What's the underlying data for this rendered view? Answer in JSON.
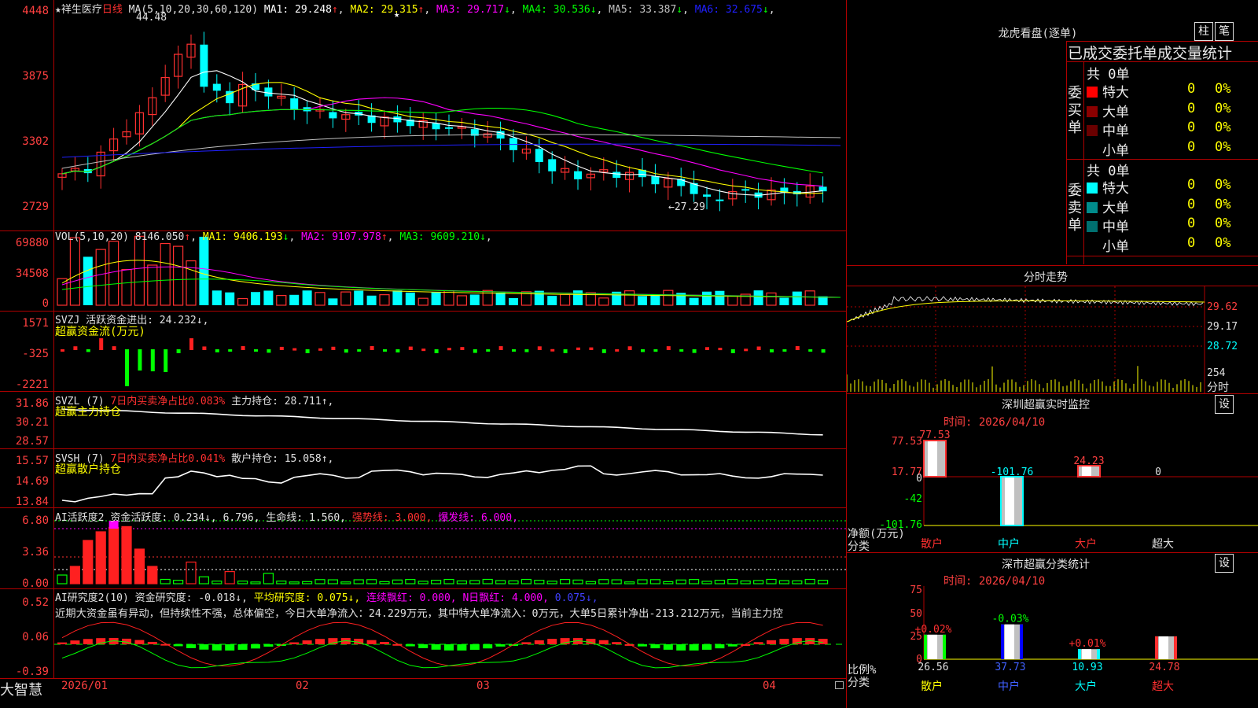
{
  "stock_name": "★祥生医疗",
  "period_tag": "日线",
  "ma_header": {
    "label": "MA(5,10,20,30,60,120)",
    "items": [
      {
        "name": "MA1",
        "value": "29.248",
        "arrow": "↑",
        "color": "#ffffff"
      },
      {
        "name": "MA2",
        "value": "29.315",
        "arrow": "↑",
        "color": "#ffff00"
      },
      {
        "name": "MA3",
        "value": "29.717",
        "arrow": "↓",
        "color": "#ff00ff"
      },
      {
        "name": "MA4",
        "value": "30.536",
        "arrow": "↓",
        "color": "#00ff00"
      },
      {
        "name": "MA5",
        "value": "33.387",
        "arrow": "↓",
        "color": "#c0c0c0"
      },
      {
        "name": "MA6",
        "value": "32.675",
        "arrow": "↓",
        "color": "#2020ff"
      }
    ]
  },
  "price_axis": [
    "4448",
    "3875",
    "3302",
    "2729"
  ],
  "high_mark": "44.48",
  "low_mark": "←27.29",
  "vol_header": {
    "label": "VOL(5,10,20)",
    "value": "8146.050",
    "arrow": "↑",
    "items": [
      {
        "name": "MA1",
        "value": "9406.193",
        "arrow": "↓",
        "color": "#ffff00"
      },
      {
        "name": "MA2",
        "value": "9107.978",
        "arrow": "↑",
        "color": "#ff00ff"
      },
      {
        "name": "MA3",
        "value": "9609.210",
        "arrow": "↓",
        "color": "#00ff00"
      }
    ]
  },
  "vol_axis": [
    "69880",
    "34508",
    "0"
  ],
  "svzj": {
    "line1": "SVZJ  活跃资金进出: 24.232↓,",
    "line2": "超赢资金流(万元)",
    "axis": [
      "1571",
      "-325",
      "-2221"
    ]
  },
  "svzl": {
    "line1_a": "SVZL (7)",
    "line1_b": "7日内买卖净占比0.083%",
    "line1_c": "主力持仓: 28.711↑,",
    "line2": "超赢主力持仓",
    "axis": [
      "31.86",
      "30.21",
      "28.57"
    ]
  },
  "svsh": {
    "line1_a": "SVSH (7)",
    "line1_b": "7日内买卖净占比0.041%",
    "line1_c": "散户持仓: 15.058↑,",
    "line2": "超赢散户持仓",
    "axis": [
      "15.57",
      "14.69",
      "13.84"
    ]
  },
  "ai2": {
    "a": "AI活跃度2",
    "b": "资金活跃度: 0.234↓,",
    "c": "6.796,",
    "d": "生命线: 1.560,",
    "e": "强势线: 3.000,",
    "f": "爆发线: 6.000,",
    "axis": [
      "6.80",
      "3.36",
      "0.00"
    ]
  },
  "ai_research": {
    "a": "AI研究度2(10)",
    "b": "资金研究度: -0.018↓,",
    "c": "平均研究度: 0.075↓,",
    "d": "连续飘红: 0.000,",
    "e": "N日飘红: 4.000,",
    "f": "0.075↓,",
    "text": "近期大资金虽有异动，但持续性不强，总体偏空，今日大单净流入：24.229万元，其中特大单净流入：0万元，大单5日累计净出-213.212万元，当前主力控",
    "axis": [
      "0.52",
      "0.06",
      "-0.39"
    ]
  },
  "date_axis": [
    "2026/01",
    "02",
    "03",
    "04"
  ],
  "brand": "大智慧",
  "right": {
    "dragon_title": "龙虎看盘(逐单)",
    "btn_pillar": "柱",
    "btn_deal": "笔",
    "stat_title": "已成交委托单成交量统计",
    "buy_label": "委买单",
    "sell_label": "委卖单",
    "buy_total": "共 0单",
    "sell_total": "共 0单",
    "buy_rows": [
      {
        "label": "特大",
        "count": "0",
        "pct": "0%",
        "color": "#ff0000"
      },
      {
        "label": "大单",
        "count": "0",
        "pct": "0%",
        "color": "#8b0000"
      },
      {
        "label": "中单",
        "count": "0",
        "pct": "0%",
        "color": "#6a0000"
      },
      {
        "label": "小单",
        "count": "0",
        "pct": "0%",
        "color": "#000000"
      }
    ],
    "sell_rows": [
      {
        "label": "特大",
        "count": "0",
        "pct": "0%",
        "color": "#00ffff"
      },
      {
        "label": "大单",
        "count": "0",
        "pct": "0%",
        "color": "#008b8b"
      },
      {
        "label": "中单",
        "count": "0",
        "pct": "0%",
        "color": "#007070"
      },
      {
        "label": "小单",
        "count": "0",
        "pct": "0%",
        "color": "#000000"
      }
    ],
    "intraday_title": "分时走势",
    "intraday_axis": [
      "29.62",
      "29.17",
      "28.72"
    ],
    "intraday_vol": "254",
    "intraday_unit": "分时",
    "sz_title": "深圳超赢实时监控",
    "sz_btn": "设",
    "sz_time": "时间: 2026/04/10",
    "sz_axis": [
      "77.53",
      "17.77",
      "0",
      "-42",
      "-101.76"
    ],
    "sz_values": [
      "77.53",
      "-101.76",
      "24.23",
      "0"
    ],
    "sz_unit": "净额(万元)",
    "sz_cat": "分类",
    "cats": [
      "散户",
      "中户",
      "大户",
      "超大"
    ],
    "cls_title": "深市超赢分类统计",
    "cls_btn": "设",
    "cls_time": "时间: 2026/04/10",
    "cls_axis": [
      "75",
      "50",
      "25",
      "0"
    ],
    "cls_top": [
      "+0.02%",
      "-0.03%",
      "+0.01%",
      ""
    ],
    "cls_values": [
      "26.56",
      "37.73",
      "10.93",
      "24.78"
    ],
    "cls_unit": "比例%",
    "cls_cat": "分类"
  }
}
